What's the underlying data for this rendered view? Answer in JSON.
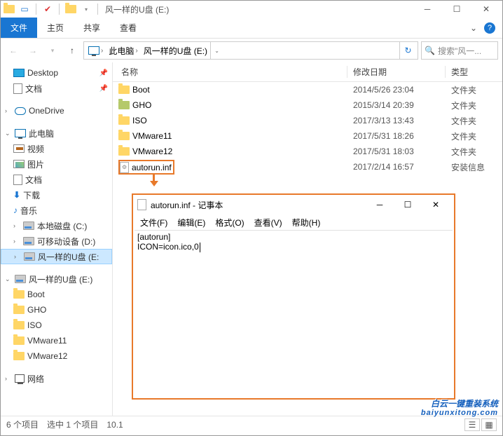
{
  "titlebar": {
    "title": "风一样的U盘 (E:)"
  },
  "ribbon": {
    "file": "文件",
    "tabs": [
      "主页",
      "共享",
      "查看"
    ]
  },
  "breadcrumb": {
    "root_icon": "pc-icon",
    "segments": [
      "此电脑",
      "风一样的U盘 (E:)"
    ]
  },
  "search": {
    "placeholder": "搜索\"风一..."
  },
  "tree": {
    "quick": [
      {
        "label": "Desktop",
        "icon": "desktop",
        "pin": true
      },
      {
        "label": "文档",
        "icon": "doc",
        "pin": true
      }
    ],
    "onedrive": "OneDrive",
    "pc": {
      "label": "此电脑",
      "children": [
        {
          "label": "视频",
          "icon": "video"
        },
        {
          "label": "图片",
          "icon": "pic"
        },
        {
          "label": "文档",
          "icon": "doc"
        },
        {
          "label": "下载",
          "icon": "down"
        },
        {
          "label": "音乐",
          "icon": "music"
        },
        {
          "label": "本地磁盘 (C:)",
          "icon": "disk"
        },
        {
          "label": "可移动设备 (D:)",
          "icon": "disk"
        },
        {
          "label": "风一样的U盘 (E:",
          "icon": "disk",
          "selected": true
        }
      ]
    },
    "drive_e": {
      "label": "风一样的U盘 (E:)",
      "children": [
        "Boot",
        "GHO",
        "ISO",
        "VMware11",
        "VMware12"
      ]
    },
    "network": "网络"
  },
  "columns": {
    "name": "名称",
    "date": "修改日期",
    "type": "类型"
  },
  "files": [
    {
      "name": "Boot",
      "date": "2014/5/26 23:04",
      "type": "文件夹",
      "icon": "folder"
    },
    {
      "name": "GHO",
      "date": "2015/3/14 20:39",
      "type": "文件夹",
      "icon": "folder-green"
    },
    {
      "name": "ISO",
      "date": "2017/3/13 13:43",
      "type": "文件夹",
      "icon": "folder"
    },
    {
      "name": "VMware11",
      "date": "2017/5/31 18:26",
      "type": "文件夹",
      "icon": "folder"
    },
    {
      "name": "VMware12",
      "date": "2017/5/31 18:03",
      "type": "文件夹",
      "icon": "folder"
    },
    {
      "name": "autorun.inf",
      "date": "2017/2/14 16:57",
      "type": "安装信息",
      "icon": "inf",
      "highlighted": true
    }
  ],
  "status": {
    "count": "6 个项目",
    "selected": "选中 1 个项目",
    "size": "10.1"
  },
  "notepad": {
    "title": "autorun.inf - 记事本",
    "menu": [
      "文件(F)",
      "编辑(E)",
      "格式(O)",
      "查看(V)",
      "帮助(H)"
    ],
    "content": "[autorun]\nICON=icon.ico,0"
  },
  "watermark": {
    "line1": "白云一键重装系统",
    "line2": "baiyunxitong.com"
  }
}
